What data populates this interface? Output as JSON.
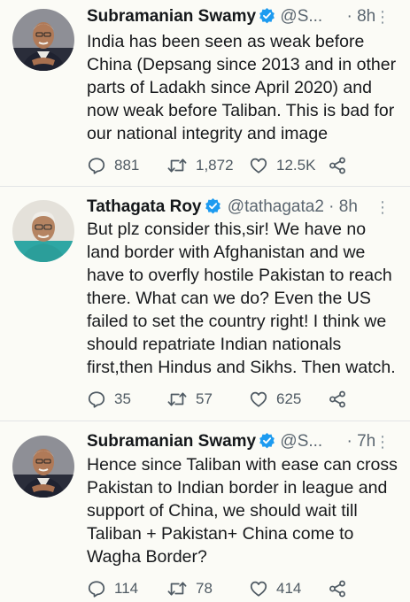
{
  "tweets": [
    {
      "display_name": "Subramanian Swamy",
      "handle": "@S...",
      "time": "· 8h",
      "more": "⋮",
      "lines": [
        "India has been seen as weak before",
        "China (Depsang since 2013 and in other",
        "parts of Ladakh since April 2020) and",
        "now weak before Taliban. This is bad for",
        "our national integrity and image"
      ],
      "replies": "881",
      "retweets": "1,872",
      "likes": "12.5K"
    },
    {
      "display_name": "Tathagata Roy",
      "handle": "@tathagata2",
      "time": "· 8h",
      "more": "⋮",
      "lines": [
        "But plz consider this,sir! We have no",
        "land border with Afghanistan and we",
        "have to overfly hostile Pakistan to reach",
        "there. What can we do? Even the US",
        "failed to set the country right! I think we",
        "should repatriate Indian nationals",
        "first,then Hindus and Sikhs. Then watch."
      ],
      "replies": "35",
      "retweets": "57",
      "likes": "625"
    },
    {
      "display_name": "Subramanian Swamy",
      "handle": "@S...",
      "time": "· 7h",
      "more": "⋮",
      "lines": [
        "Hence since Taliban with ease can cross",
        "Pakistan to Indian border in league and",
        "support of China, we should wait till",
        "Taliban + Pakistan+ China come to",
        "Wagha Border?"
      ],
      "replies": "114",
      "retweets": "78",
      "likes": "414"
    }
  ],
  "icons": {
    "verified": "verified-badge-icon",
    "reply": "reply-bubble-icon",
    "retweet": "retweet-arrows-icon",
    "like": "heart-icon",
    "share": "share-icon"
  },
  "colors": {
    "background": "#fbfbf6",
    "verified": "#1d9bf0",
    "secondary_text": "#5b6670",
    "divider": "#e3e5e6"
  }
}
